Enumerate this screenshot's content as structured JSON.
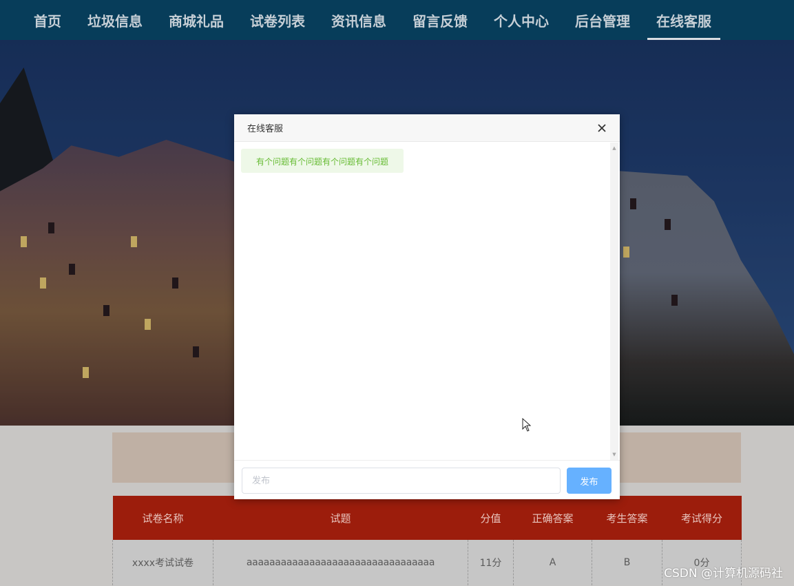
{
  "nav": {
    "items": [
      {
        "label": "首页"
      },
      {
        "label": "垃圾信息"
      },
      {
        "label": "商城礼品"
      },
      {
        "label": "试卷列表"
      },
      {
        "label": "资讯信息"
      },
      {
        "label": "留言反馈"
      },
      {
        "label": "个人中心"
      },
      {
        "label": "后台管理"
      },
      {
        "label": "在线客服",
        "active": true
      }
    ]
  },
  "table": {
    "headers": [
      "试卷名称",
      "试题",
      "分值",
      "正确答案",
      "考生答案",
      "考试得分"
    ],
    "rows": [
      [
        "xxxx考试试卷",
        "aaaaaaaaaaaaaaaaaaaaaaaaaaaaaaaaa",
        "11分",
        "A",
        "B",
        "0分"
      ]
    ]
  },
  "dialog": {
    "title": "在线客服",
    "close_icon": "close-icon",
    "messages": [
      {
        "text": "有个问题有个问题有个问题有个问题"
      }
    ],
    "input_placeholder": "发布",
    "send_label": "发布"
  },
  "watermark": "CSDN @计算机源码社",
  "colors": {
    "nav_bg": "#073d5a",
    "table_header_bg": "#9c1d0c",
    "send_button": "#66b1ff",
    "bubble_bg": "#eef8e8",
    "bubble_text": "#66bb33"
  }
}
